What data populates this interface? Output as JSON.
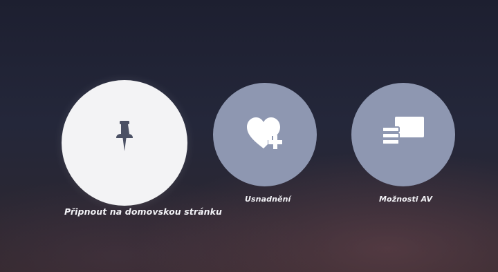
{
  "menu": {
    "items": [
      {
        "label": "Připnout na domovskou stránku",
        "icon": "pushpin-icon",
        "selected": true
      },
      {
        "label": "Usnadnění",
        "icon": "heart-plus-icon",
        "selected": false
      },
      {
        "label": "Možnosti AV",
        "icon": "av-options-icon",
        "selected": false
      }
    ]
  },
  "colors": {
    "selected_circle": "#f3f3f5",
    "unselected_circle": "#8e97b1",
    "icon_dark": "#4b5064",
    "icon_light": "#ffffff",
    "label_text": "#f2f2f6",
    "background": "#24273a"
  }
}
